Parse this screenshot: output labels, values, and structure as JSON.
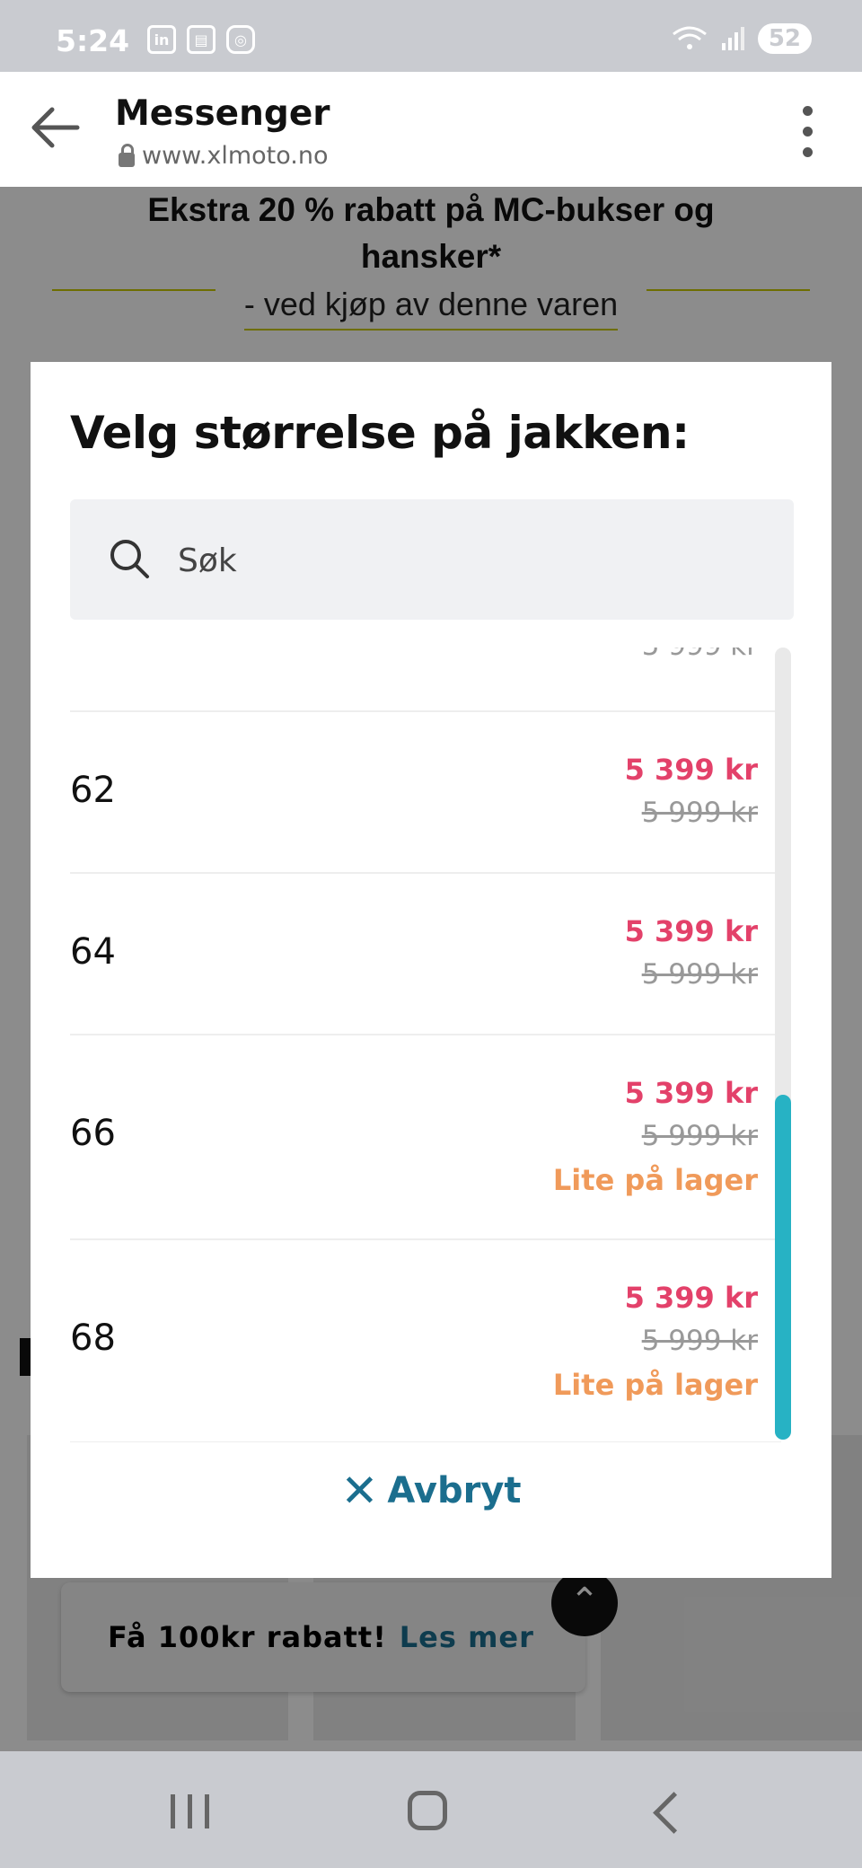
{
  "status_bar": {
    "time": "5:24",
    "battery": "52",
    "notification_icons": [
      "linkedin-icon",
      "calendar-icon",
      "instagram-icon"
    ]
  },
  "browser": {
    "title": "Messenger",
    "url": "www.xlmoto.no"
  },
  "promo": {
    "headline": "Ekstra 20 % rabatt på MC-bukser og hansker*",
    "subline": "- ved kjøp av denne varen"
  },
  "modal": {
    "title": "Velg størrelse på jakken:",
    "search_placeholder": "Søk",
    "partial_top_old_price": "5 999 kr",
    "sizes": [
      {
        "size": "62",
        "price": "5 399 kr",
        "old_price": "5 999 kr",
        "stock": ""
      },
      {
        "size": "64",
        "price": "5 399 kr",
        "old_price": "5 999 kr",
        "stock": ""
      },
      {
        "size": "66",
        "price": "5 399 kr",
        "old_price": "5 999 kr",
        "stock": "Lite på lager"
      },
      {
        "size": "68",
        "price": "5 399 kr",
        "old_price": "5 999 kr",
        "stock": "Lite på lager"
      }
    ],
    "cancel_label": "Avbryt"
  },
  "toast": {
    "text": "Få 100kr rabatt!",
    "link": "Les mer"
  },
  "colors": {
    "price": "#e3416a",
    "stock": "#f09a5a",
    "accent": "#1b6e8e",
    "scroll_thumb": "#27b2c4"
  }
}
